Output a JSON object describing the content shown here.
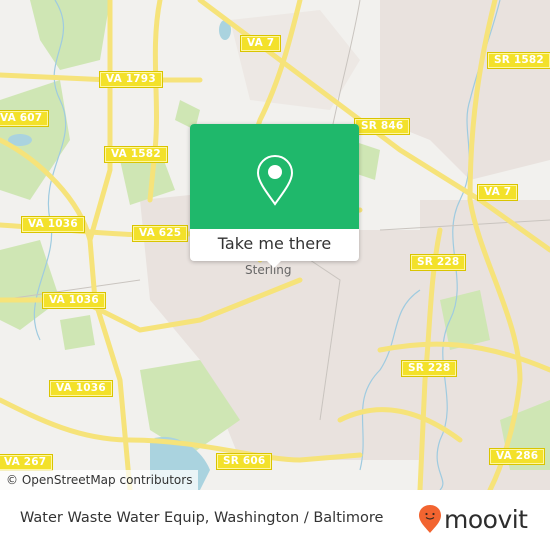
{
  "map": {
    "road_labels": [
      {
        "text": "VA 7",
        "id": "va-7-north"
      },
      {
        "text": "VA 1793",
        "id": "va-1793"
      },
      {
        "text": "SR 1582",
        "id": "sr-1582"
      },
      {
        "text": "VA 607",
        "id": "va-607"
      },
      {
        "text": "VA 1582",
        "id": "va-1582"
      },
      {
        "text": "SR 846",
        "id": "sr-846"
      },
      {
        "text": "VA 7",
        "id": "va-7-east"
      },
      {
        "text": "VA 1036",
        "id": "va-1036-a"
      },
      {
        "text": "VA 625",
        "id": "va-625"
      },
      {
        "text": "SR 228",
        "id": "sr-228-a"
      },
      {
        "text": "VA 1036",
        "id": "va-1036-b"
      },
      {
        "text": "SR 228",
        "id": "sr-228-b"
      },
      {
        "text": "VA 1036",
        "id": "va-1036-c"
      },
      {
        "text": "VA 267",
        "id": "va-267"
      },
      {
        "text": "SR 606",
        "id": "sr-606"
      },
      {
        "text": "VA 286",
        "id": "va-286"
      }
    ],
    "place_label": "Sterling",
    "attribution": "© OpenStreetMap contributors",
    "colors": {
      "background": "#f2f1ee",
      "road": "#f6e37a",
      "park": "#cfe6b4",
      "water": "#aad3df",
      "urban": "#e8e0dc"
    }
  },
  "popup": {
    "icon": "map-pin-icon",
    "button_label": "Take me there",
    "color": "#1fb86b"
  },
  "footer": {
    "title": "Water Waste Water Equip, Washington / Baltimore",
    "brand": "moovit",
    "brand_color": "#f26430"
  }
}
